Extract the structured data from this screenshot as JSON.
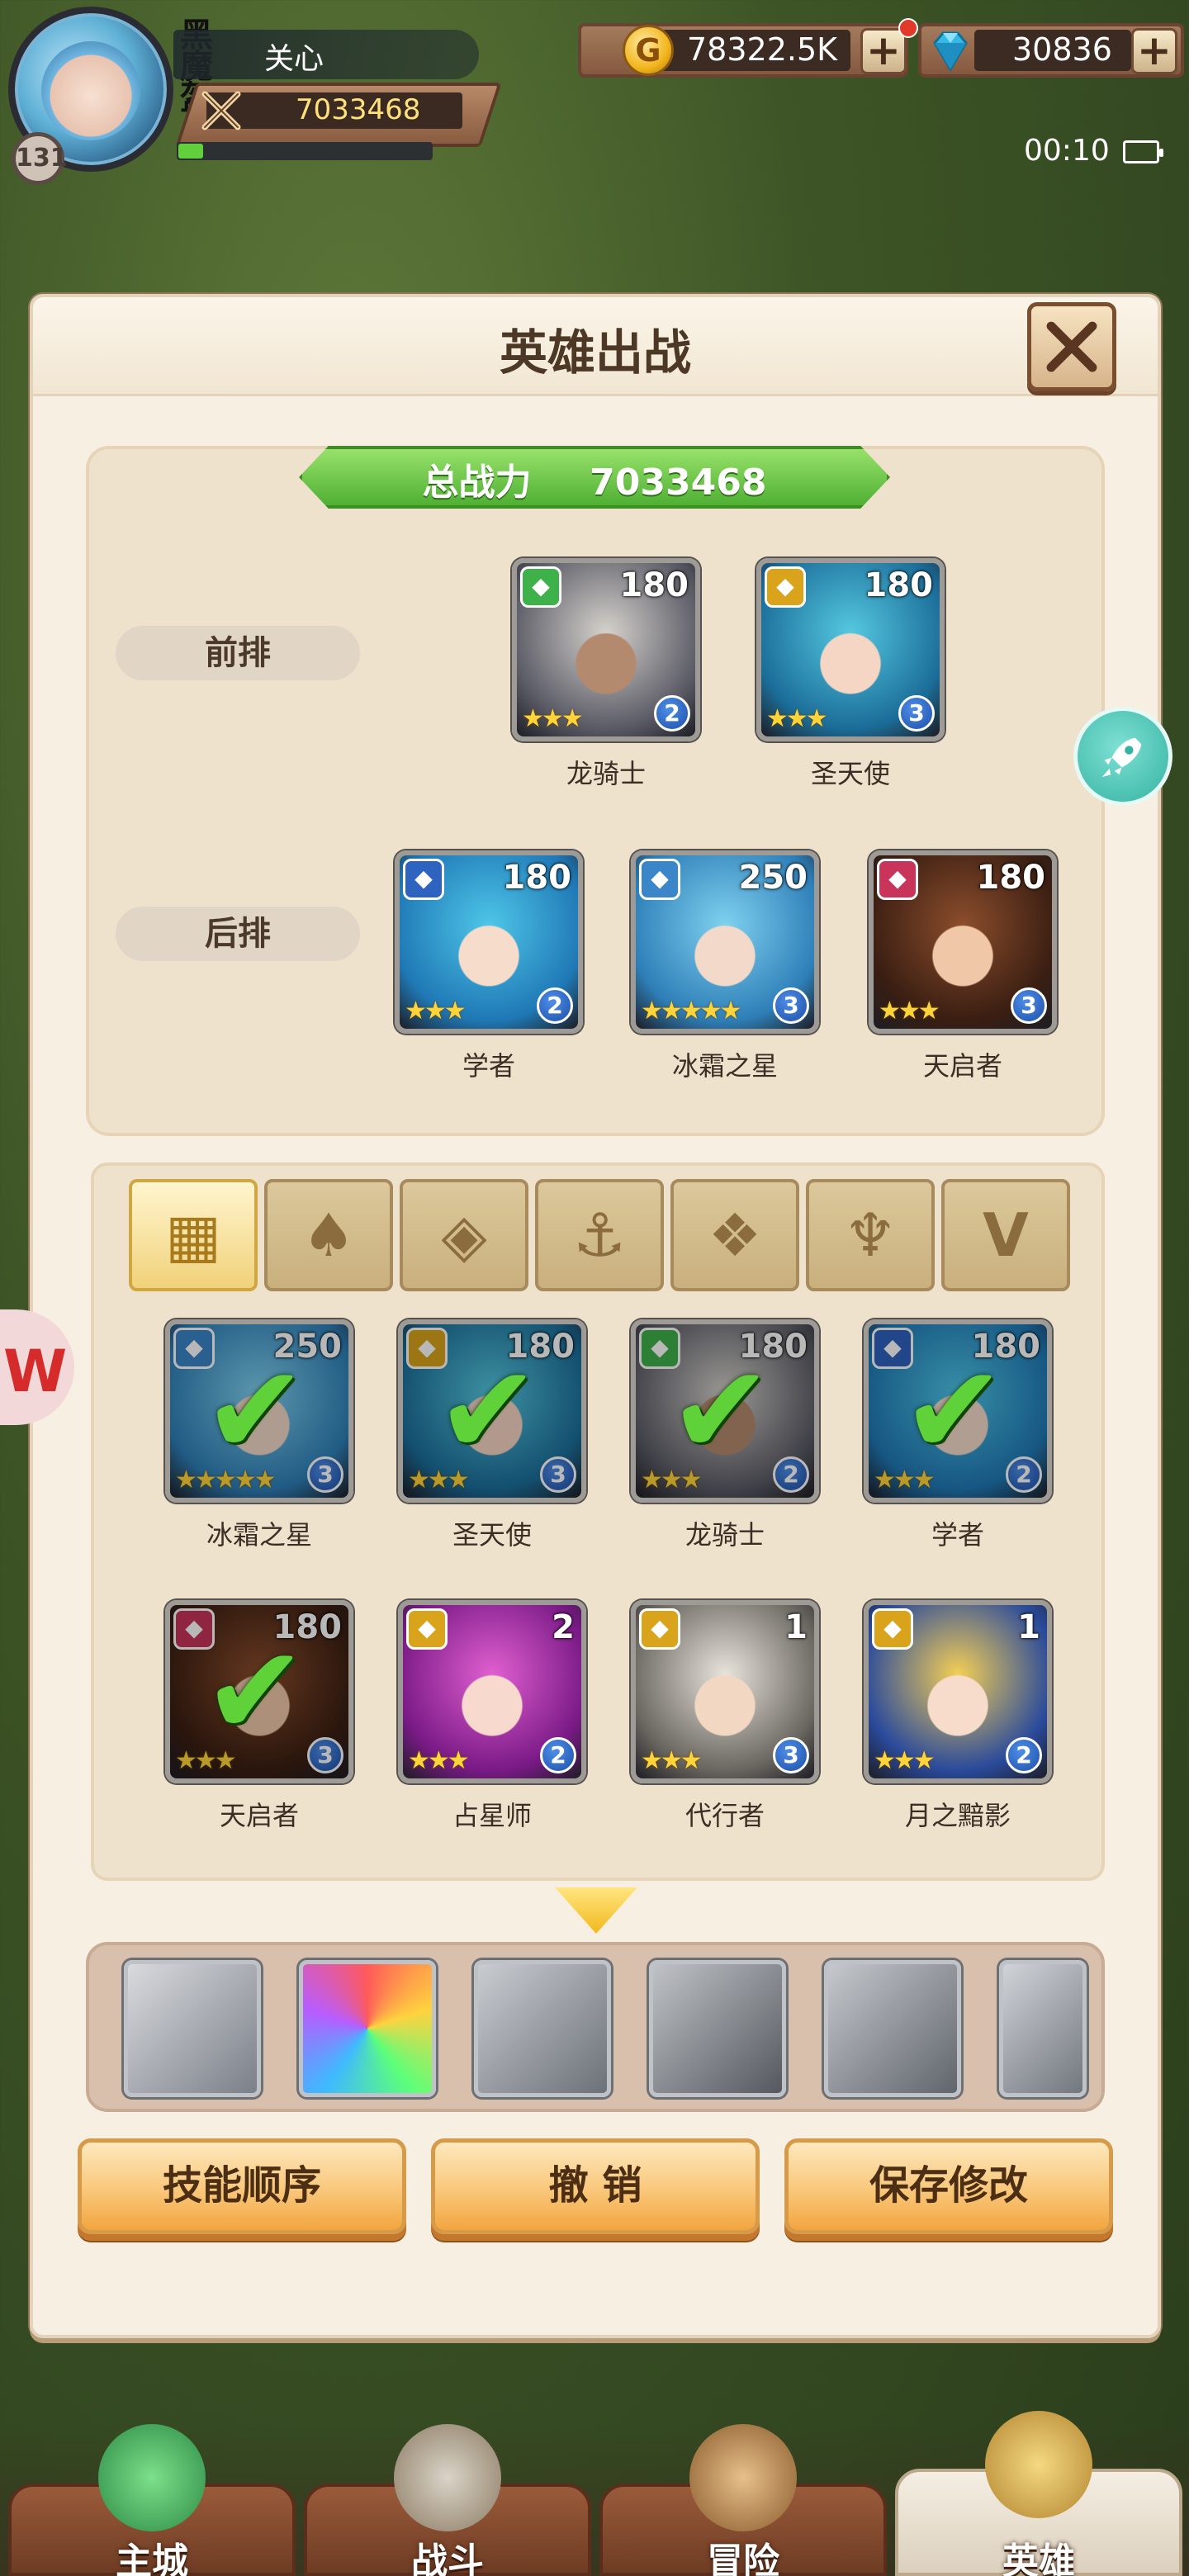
{
  "hud": {
    "player_name": "关心",
    "guild_tag": "黑魔盔",
    "level": "131",
    "power": "7033468",
    "gold": "78322.5K",
    "gems": "30836",
    "time": "00:10",
    "gold_icon": "G"
  },
  "dialog": {
    "title": "英雄出战",
    "total_power_label": "总战力",
    "total_power": "7033468",
    "front_row_label": "前排",
    "back_row_label": "后排"
  },
  "front_row": [
    {
      "name": "龙骑士",
      "level": "180",
      "rank": "2",
      "stars": "★★★",
      "class_icon": "dragon-class-icon",
      "class_color": "#3fb14a"
    },
    {
      "name": "圣天使",
      "level": "180",
      "rank": "3",
      "stars": "★★★",
      "class_icon": "wing-class-icon",
      "class_color": "#d9a41b"
    }
  ],
  "back_row": [
    {
      "name": "学者",
      "level": "180",
      "rank": "2",
      "stars": "★★★",
      "class_icon": "anchor-class-icon",
      "class_color": "#2f63c0"
    },
    {
      "name": "冰霜之星",
      "level": "250",
      "rank": "3",
      "stars": "★★★★★",
      "class_icon": "diamond-class-icon",
      "class_color": "#3a86c8"
    },
    {
      "name": "天启者",
      "level": "180",
      "rank": "3",
      "stars": "★★★",
      "class_icon": "flame-class-icon",
      "class_color": "#c8345a"
    }
  ],
  "filter_tabs": [
    {
      "icon": "all-grid-icon",
      "glyph": "▦"
    },
    {
      "icon": "leaf-class-icon",
      "glyph": "♠"
    },
    {
      "icon": "diamond-class-icon",
      "glyph": "◈"
    },
    {
      "icon": "anchor-class-icon",
      "glyph": "⚓"
    },
    {
      "icon": "dragon-class-icon",
      "glyph": "❖"
    },
    {
      "icon": "horn-class-icon",
      "glyph": "♆"
    },
    {
      "icon": "wing-class-icon",
      "glyph": "V"
    }
  ],
  "hero_list": [
    {
      "name": "冰霜之星",
      "level": "250",
      "rank": "3",
      "stars": "★★★★★",
      "selected": true,
      "class_color": "#3a86c8"
    },
    {
      "name": "圣天使",
      "level": "180",
      "rank": "3",
      "stars": "★★★",
      "selected": true,
      "class_color": "#d9a41b"
    },
    {
      "name": "龙骑士",
      "level": "180",
      "rank": "2",
      "stars": "★★★",
      "selected": true,
      "class_color": "#3fb14a"
    },
    {
      "name": "学者",
      "level": "180",
      "rank": "2",
      "stars": "★★★",
      "selected": true,
      "class_color": "#2f63c0"
    },
    {
      "name": "天启者",
      "level": "180",
      "rank": "3",
      "stars": "★★★",
      "selected": true,
      "class_color": "#c8345a"
    },
    {
      "name": "占星师",
      "level": "2",
      "rank": "2",
      "stars": "★★★",
      "selected": false,
      "class_color": "#d9a41b"
    },
    {
      "name": "代行者",
      "level": "1",
      "rank": "3",
      "stars": "★★★",
      "selected": false,
      "class_color": "#d9a41b"
    },
    {
      "name": "月之黯影",
      "level": "1",
      "rank": "2",
      "stars": "★★★",
      "selected": false,
      "class_color": "#d9a41b"
    }
  ],
  "skills": [
    "wing-skill-icon",
    "prism-skill-icon",
    "shield-skill-icon",
    "strike-skill-icon",
    "crest-skill-icon",
    "swirl-skill-icon"
  ],
  "buttons": {
    "skill_order": "技能顺序",
    "undo": "撤 销",
    "save": "保存修改"
  },
  "nav": [
    {
      "label": "主城",
      "icon": "castle-nav-icon",
      "active": false
    },
    {
      "label": "战斗",
      "icon": "swords-nav-icon",
      "active": false
    },
    {
      "label": "冒险",
      "icon": "map-nav-icon",
      "active": false
    },
    {
      "label": "英雄",
      "icon": "hero-nav-icon",
      "active": true
    }
  ],
  "colors": {
    "accent_green": "#5fd23a",
    "banner_green": "#4fb034",
    "button_orange": "#f9c77a",
    "dialog_bg": "#f7efe1"
  }
}
